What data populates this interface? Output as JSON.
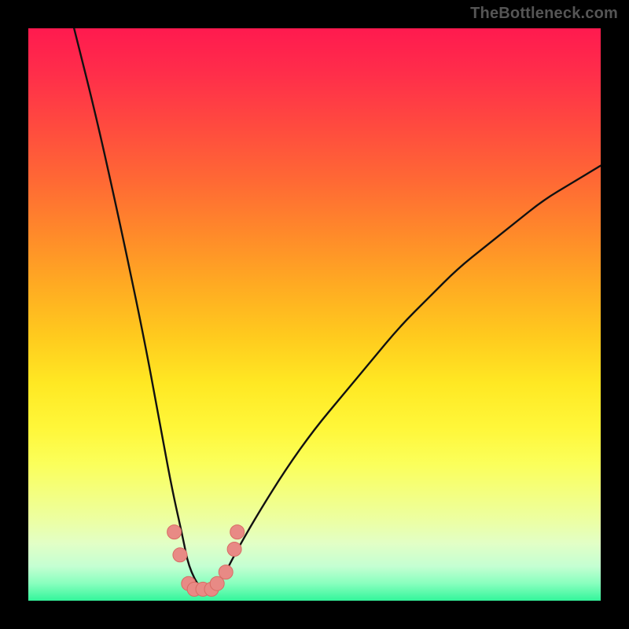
{
  "watermark": "TheBottleneck.com",
  "colors": {
    "background_black": "#000000",
    "gradient_top": "#ff1a4f",
    "gradient_bottom": "#33f59b",
    "curve_stroke": "#111111",
    "marker_fill": "#e88a85"
  },
  "chart_data": {
    "type": "line",
    "title": "",
    "xlabel": "",
    "ylabel": "",
    "xlim": [
      0,
      100
    ],
    "ylim": [
      0,
      100
    ],
    "grid": false,
    "legend": false,
    "note": "Bottleneck-style V curve; minimum near x≈30. Values are visual estimates (no axis ticks present).",
    "series": [
      {
        "name": "bottleneck_curve",
        "x": [
          8,
          12,
          16,
          20,
          23,
          25,
          27,
          28,
          30,
          32,
          34,
          36,
          40,
          45,
          50,
          55,
          60,
          65,
          70,
          75,
          80,
          85,
          90,
          95,
          100
        ],
        "y": [
          100,
          84,
          66,
          47,
          31,
          20,
          11,
          6,
          2,
          2,
          4,
          8,
          15,
          23,
          30,
          36,
          42,
          48,
          53,
          58,
          62,
          66,
          70,
          73,
          76
        ]
      }
    ],
    "markers": {
      "name": "highlight_points",
      "note": "Salmon dots clustered near the curve minimum",
      "points": [
        {
          "x": 25.5,
          "y": 12
        },
        {
          "x": 26.5,
          "y": 8
        },
        {
          "x": 28.0,
          "y": 3
        },
        {
          "x": 29.0,
          "y": 2
        },
        {
          "x": 30.5,
          "y": 2
        },
        {
          "x": 32.0,
          "y": 2
        },
        {
          "x": 33.0,
          "y": 3
        },
        {
          "x": 34.5,
          "y": 5
        },
        {
          "x": 36.0,
          "y": 9
        },
        {
          "x": 36.5,
          "y": 12
        }
      ]
    }
  }
}
